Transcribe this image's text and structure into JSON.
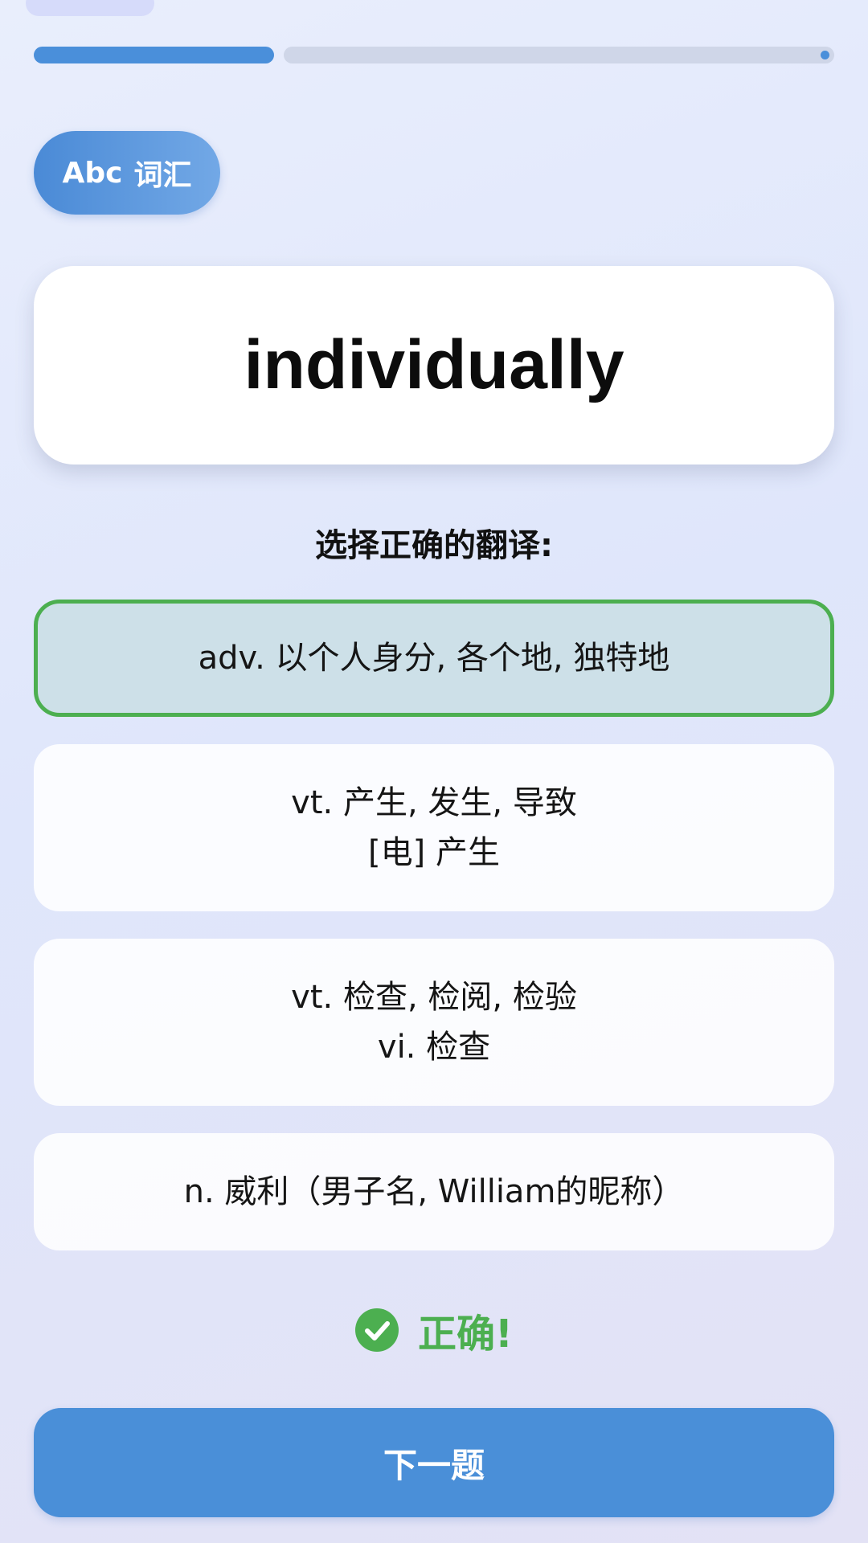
{
  "progress": {
    "value": 0.3
  },
  "category": {
    "icon_text": "Abc",
    "label": "词汇",
    "icon": "abc-icon"
  },
  "question": {
    "word": "individually",
    "prompt": "选择正确的翻译:"
  },
  "options": [
    {
      "lines": [
        "adv. 以个人身分, 各个地, 独特地"
      ],
      "selected": true
    },
    {
      "lines": [
        "vt. 产生, 发生, 导致",
        "[电] 产生"
      ],
      "selected": false
    },
    {
      "lines": [
        "vt. 检查, 检阅, 检验",
        "vi. 检查"
      ],
      "selected": false
    },
    {
      "lines": [
        "n. 威利（男子名, William的昵称）"
      ],
      "selected": false
    }
  ],
  "result": {
    "text": "正确!",
    "icon": "check-circle-icon",
    "color": "#4caf50"
  },
  "next_button": {
    "label": "下一题"
  },
  "colors": {
    "accent": "#4a8fda",
    "correct": "#4caf50",
    "track": "#cfd6e8"
  }
}
